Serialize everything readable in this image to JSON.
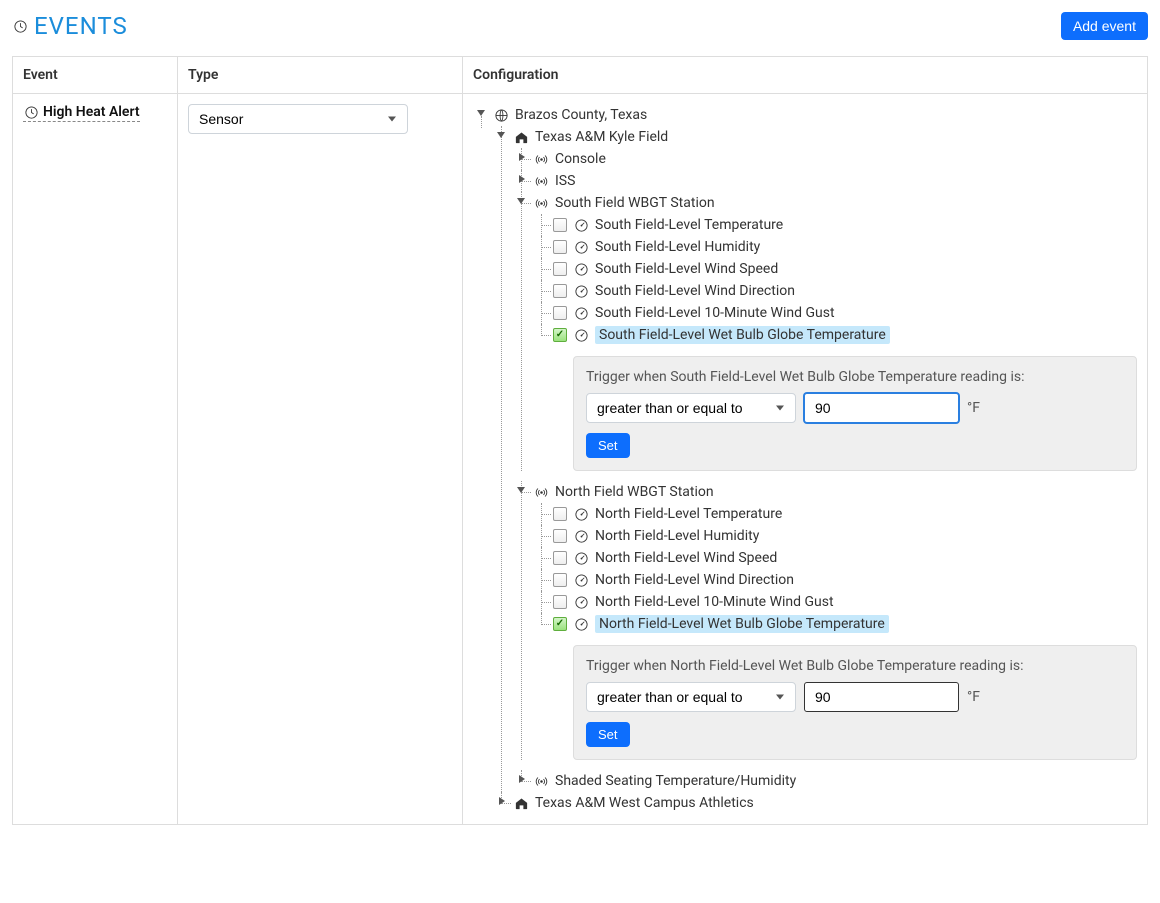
{
  "page_title": "EVENTS",
  "add_button": "Add event",
  "columns": {
    "event": "Event",
    "type": "Type",
    "config": "Configuration"
  },
  "event_row": {
    "name": "High Heat Alert",
    "type_selected": "Sensor"
  },
  "tree": {
    "root": "Brazos County, Texas",
    "site1": "Texas A&M Kyle Field",
    "site2": "Texas A&M West Campus Athletics",
    "console": "Console",
    "iss": "ISS",
    "south_station": "South Field WBGT Station",
    "north_station": "North Field WBGT Station",
    "shaded": "Shaded Seating Temperature/Humidity",
    "south": {
      "temp": "South Field-Level Temperature",
      "hum": "South Field-Level Humidity",
      "ws": "South Field-Level Wind Speed",
      "wd": "South Field-Level Wind Direction",
      "gust": "South Field-Level 10-Minute Wind Gust",
      "wbgt": "South Field-Level Wet Bulb Globe Temperature"
    },
    "north": {
      "temp": "North Field-Level Temperature",
      "hum": "North Field-Level Humidity",
      "ws": "North Field-Level Wind Speed",
      "wd": "North Field-Level Wind Direction",
      "gust": "North Field-Level 10-Minute Wind Gust",
      "wbgt": "North Field-Level Wet Bulb Globe Temperature"
    }
  },
  "trigger": {
    "south_prompt": "Trigger when South Field-Level Wet Bulb Globe Temperature reading is:",
    "north_prompt": "Trigger when North Field-Level Wet Bulb Globe Temperature reading is:",
    "operator": "greater than or equal to",
    "south_value": "90",
    "north_value": "90",
    "unit": "°F",
    "set_label": "Set"
  }
}
